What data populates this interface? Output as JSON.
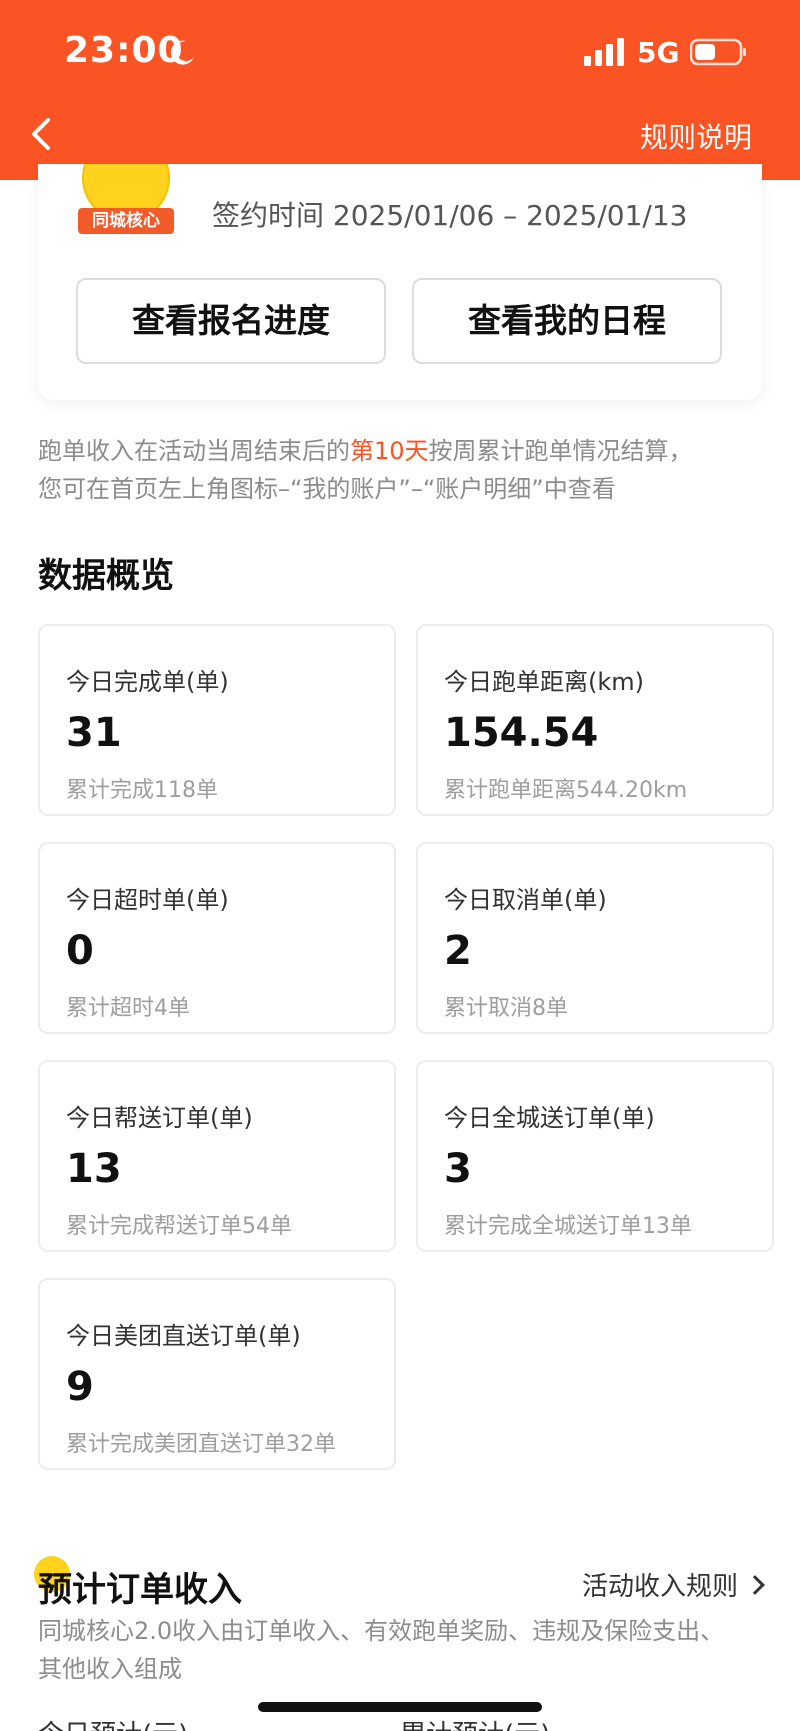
{
  "status_bar": {
    "time": "23:00",
    "network": "5G"
  },
  "header": {
    "rules_label": "规则说明"
  },
  "signup_card": {
    "avatar_badge": "同城核心",
    "sign_time": "签约时间 2025/01/06 – 2025/01/13",
    "btn_progress": "查看报名进度",
    "btn_schedule": "查看我的日程"
  },
  "note": {
    "part1": "跑单收入在活动当周结束后的",
    "highlight": "第10天",
    "part2": "按周累计跑单情况结算，",
    "line2": "您可在首页左上角图标–“我的账户”–“账户明细”中查看"
  },
  "overview": {
    "title": "数据概览",
    "cards": [
      {
        "label": "今日完成单(单)",
        "value": "31",
        "sub": "累计完成118单"
      },
      {
        "label": "今日跑单距离(km)",
        "value": "154.54",
        "sub": "累计跑单距离544.20km"
      },
      {
        "label": "今日超时单(单)",
        "value": "0",
        "sub": "累计超时4单"
      },
      {
        "label": "今日取消单(单)",
        "value": "2",
        "sub": "累计取消8单"
      },
      {
        "label": "今日帮送订单(单)",
        "value": "13",
        "sub": "累计完成帮送订单54单"
      },
      {
        "label": "今日全城送订单(单)",
        "value": "3",
        "sub": "累计完成全城送订单13单"
      },
      {
        "label": "今日美团直送订单(单)",
        "value": "9",
        "sub": "累计完成美团直送订单32单"
      }
    ]
  },
  "income": {
    "title": "预计订单收入",
    "rules_link": "活动收入规则",
    "desc": "同城核心2.0收入由订单收入、有效跑单奖励、违规及保险支出、其他收入组成",
    "col_today": "今日预计(元)",
    "col_total": "累计预计(元)"
  },
  "colors": {
    "brand": "#fb5424",
    "highlight": "#fb5424",
    "badge": "#f35a2a"
  }
}
